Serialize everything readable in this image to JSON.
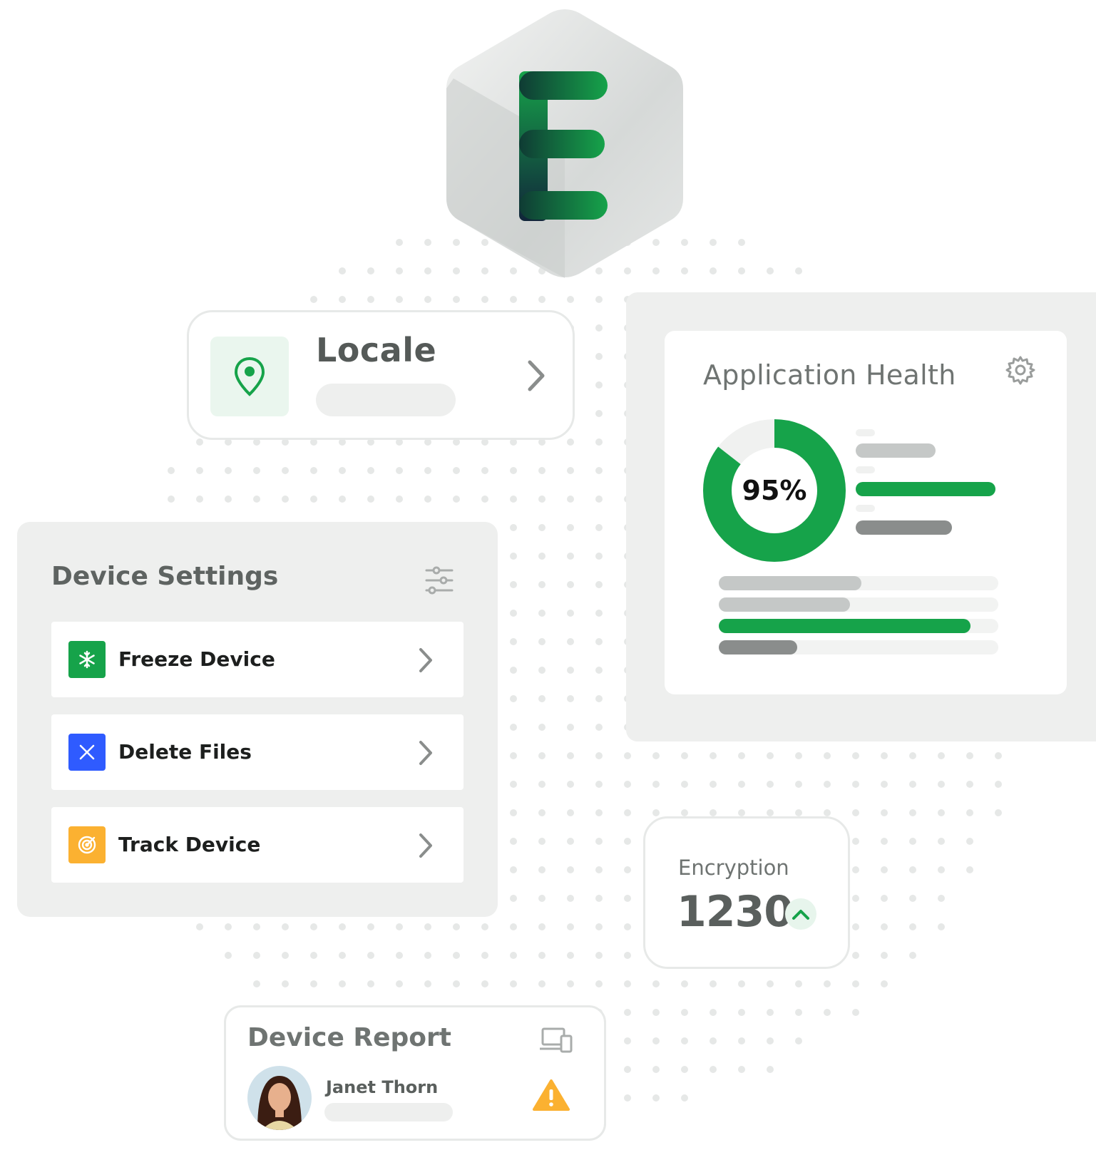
{
  "brand": {
    "logo_letter": "E",
    "logo_icon": "brand-e-hexagon-icon",
    "accent": "#16a34a",
    "accent_dark": "#0f2b3c"
  },
  "locale": {
    "title": "Locale",
    "icon": "location-pin-icon"
  },
  "application_health": {
    "title": "Application Health",
    "percent_label": "95%",
    "percent_value": 95,
    "settings_icon": "gear-icon",
    "donut_color": "#16a34a",
    "right_bars": [
      {
        "fill": 0.14,
        "color": "#f0f1f0",
        "track": "#ffffff"
      },
      {
        "fill": 0.57,
        "color": "#c5c8c7",
        "track": "#ffffff"
      },
      {
        "fill": 0.14,
        "color": "#f0f1f0",
        "track": "#ffffff"
      },
      {
        "fill": 1.0,
        "color": "#16a34a",
        "track": "#ffffff"
      },
      {
        "fill": 0.14,
        "color": "#f0f1f0",
        "track": "#ffffff"
      },
      {
        "fill": 0.69,
        "color": "#8a8d8c",
        "track": "#ffffff"
      }
    ],
    "bottom_bars": [
      {
        "fill": 0.51,
        "color": "#c5c8c7"
      },
      {
        "fill": 0.47,
        "color": "#c5c8c7"
      },
      {
        "fill": 0.9,
        "color": "#16a34a"
      },
      {
        "fill": 0.28,
        "color": "#8a8d8c"
      }
    ]
  },
  "device_settings": {
    "title": "Device Settings",
    "filter_icon": "sliders-icon",
    "items": [
      {
        "label": "Freeze Device",
        "icon": "snowflake-icon",
        "color": "#16a34a"
      },
      {
        "label": "Delete Files",
        "icon": "close-icon",
        "color": "#2f5bff"
      },
      {
        "label": "Track Device",
        "icon": "target-icon",
        "color": "#fbb131"
      }
    ]
  },
  "encryption": {
    "label": "Encryption",
    "value": "1230",
    "trend_icon": "chevron-up-icon"
  },
  "device_report": {
    "title": "Device Report",
    "devices_icon": "devices-icon",
    "user_name": "Janet Thorn",
    "alert_icon": "warning-icon",
    "alert_color": "#fbb131"
  }
}
